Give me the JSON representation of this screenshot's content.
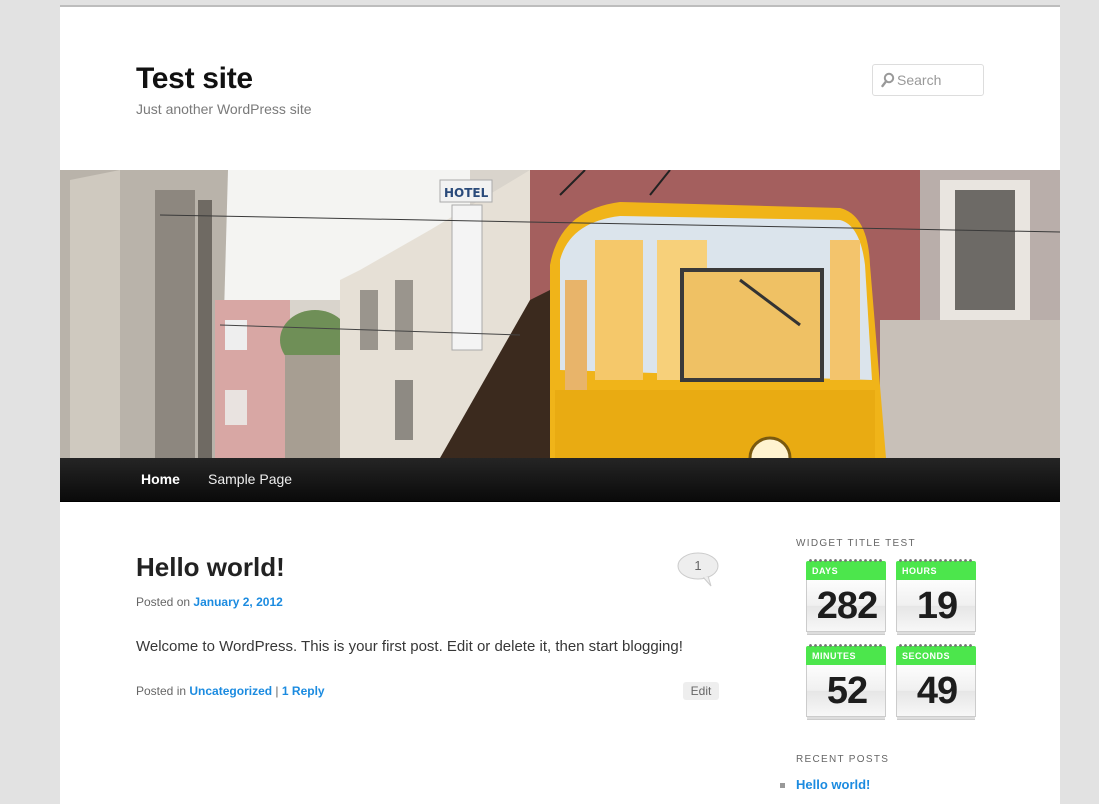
{
  "site": {
    "title": "Test site",
    "tagline": "Just another WordPress site"
  },
  "search": {
    "placeholder": "Search"
  },
  "nav": {
    "items": [
      {
        "label": "Home"
      },
      {
        "label": "Sample Page"
      }
    ]
  },
  "post": {
    "title": "Hello world!",
    "comment_count": "1",
    "posted_on_prefix": "Posted on",
    "date": "January 2, 2012",
    "content": "Welcome to WordPress. This is your first post. Edit or delete it, then start blogging!",
    "posted_in_prefix": "Posted in",
    "category": "Uncategorized",
    "separator": "|",
    "reply_link": "1 Reply",
    "edit_label": "Edit"
  },
  "sidebar": {
    "countdown_widget": {
      "title": "WIDGET TITLE TEST",
      "days_label": "DAYS",
      "days": "282",
      "hours_label": "HOURS",
      "hours": "19",
      "minutes_label": "MINUTES",
      "minutes": "52",
      "seconds_label": "SECONDS",
      "seconds": "49"
    },
    "recent_posts": {
      "title": "RECENT POSTS",
      "items": [
        {
          "label": "Hello world!"
        }
      ]
    }
  },
  "colors": {
    "link": "#1b8be0",
    "countdown_green": "#4ce64c",
    "nav_bg": "#111111",
    "tram_yellow": "#f0b419"
  }
}
